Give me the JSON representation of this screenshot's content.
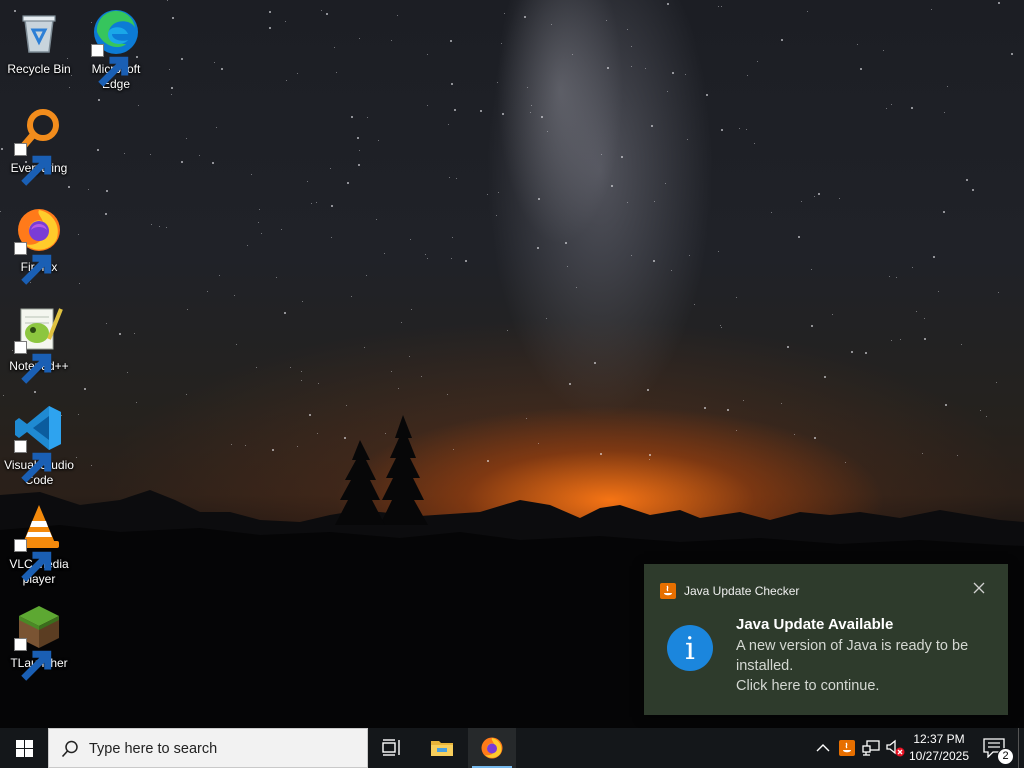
{
  "desktop": {
    "icons": [
      {
        "label": "Recycle Bin",
        "icon": "recycle-bin-icon"
      },
      {
        "label": "Microsoft Edge",
        "icon": "edge-icon"
      },
      {
        "label": "Everything",
        "icon": "everything-icon"
      },
      {
        "label": "Firefox",
        "icon": "firefox-icon"
      },
      {
        "label": "Notepad++",
        "icon": "notepadpp-icon"
      },
      {
        "label": "Visual Studio Code",
        "icon": "vscode-icon"
      },
      {
        "label": "VLC media player",
        "icon": "vlc-icon"
      },
      {
        "label": "TLauncher",
        "icon": "tlauncher-icon"
      }
    ]
  },
  "toast": {
    "app_name": "Java Update Checker",
    "title": "Java Update Available",
    "message_line1": "A new version of Java is ready to be installed.",
    "message_line2": "Click here to continue.",
    "info_glyph": "i",
    "background": "#2e3b2c"
  },
  "taskbar": {
    "search_placeholder": "Type here to search",
    "pinned": [
      "task-view-icon",
      "file-explorer-icon",
      "firefox-icon"
    ],
    "active_app": "Firefox",
    "clock_time": "12:37 PM",
    "clock_date": "10/27/2025",
    "notification_count": "2",
    "accent": "#76b9ed"
  }
}
